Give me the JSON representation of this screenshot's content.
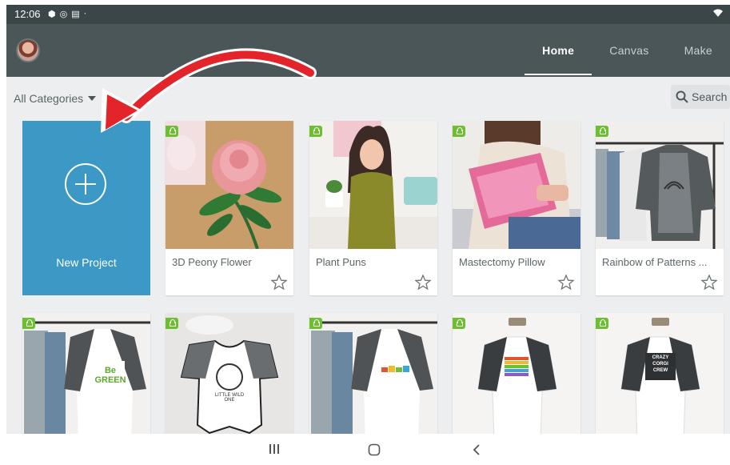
{
  "status_bar": {
    "time": "12:06",
    "icons": [
      "shield-icon",
      "at-icon",
      "message-icon",
      "dot"
    ]
  },
  "app_bar": {
    "tabs": [
      {
        "label": "Home",
        "active": true
      },
      {
        "label": "Canvas"
      },
      {
        "label": "Make"
      }
    ]
  },
  "filter": {
    "category_label": "All Categories",
    "search_label": "Search"
  },
  "new_project": {
    "label": "New Project"
  },
  "projects": [
    {
      "title": "3D Peony Flower"
    },
    {
      "title": "Plant Puns"
    },
    {
      "title": "Mastectomy Pillow"
    },
    {
      "title": "Rainbow of Patterns ..."
    }
  ],
  "row2_cards": [
    {
      "shirt_text": "Be GREEN"
    },
    {
      "shirt_text": "LITTLE WILD ONE"
    },
    {
      "shirt_text": ""
    },
    {
      "shirt_text": ""
    },
    {
      "shirt_text": "CRAZY CORGI CREW"
    }
  ],
  "colors": {
    "accent": "#3c98c5",
    "app_bar": "#4b5659",
    "badge": "#6cbf2f",
    "arrow": "#e3242b"
  }
}
